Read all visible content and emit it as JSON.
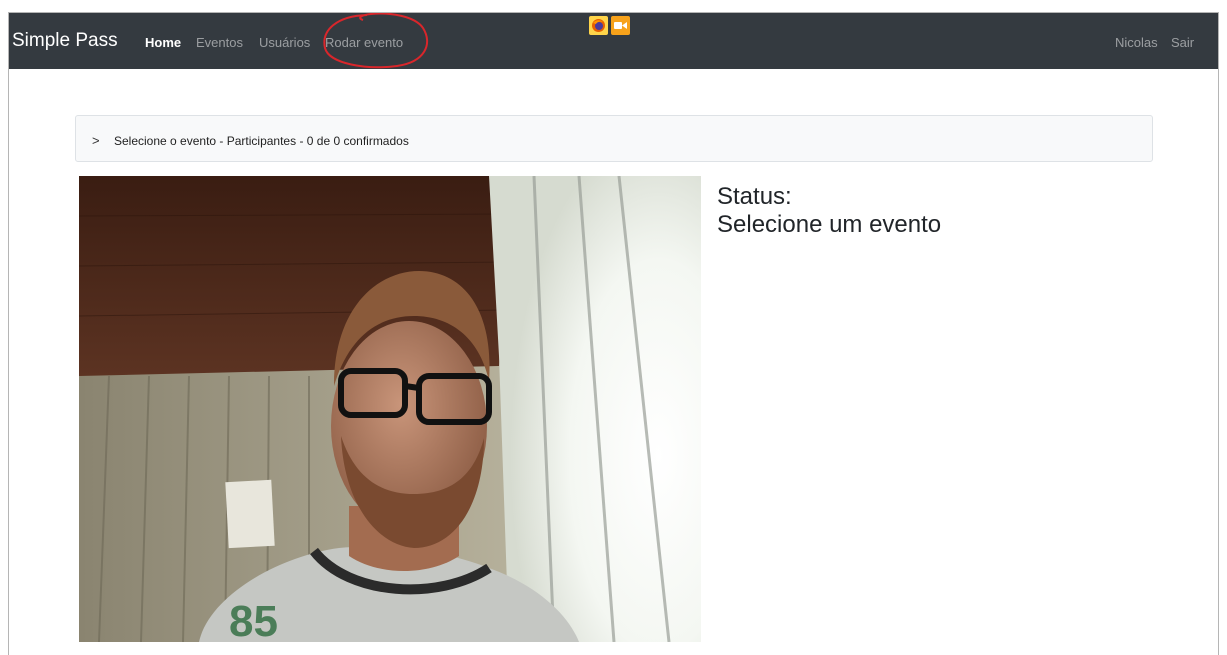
{
  "navbar": {
    "brand": "Simple Pass",
    "links": [
      {
        "label": "Home"
      },
      {
        "label": "Eventos"
      },
      {
        "label": "Usuários"
      },
      {
        "label": "Rodar evento"
      }
    ],
    "user": "Nicolas",
    "logout": "Sair"
  },
  "accordion": {
    "chevron": ">",
    "label": "Selecione o evento - Participantes - 0 de 0 confirmados"
  },
  "status": {
    "label": "Status:",
    "value": "Selecione um evento"
  },
  "indicators": [
    "firefox-icon",
    "camera-icon"
  ],
  "colors": {
    "navbar_bg": "#343a40",
    "annotation": "#d9262b",
    "camera_indicator": "#f7a21b"
  }
}
